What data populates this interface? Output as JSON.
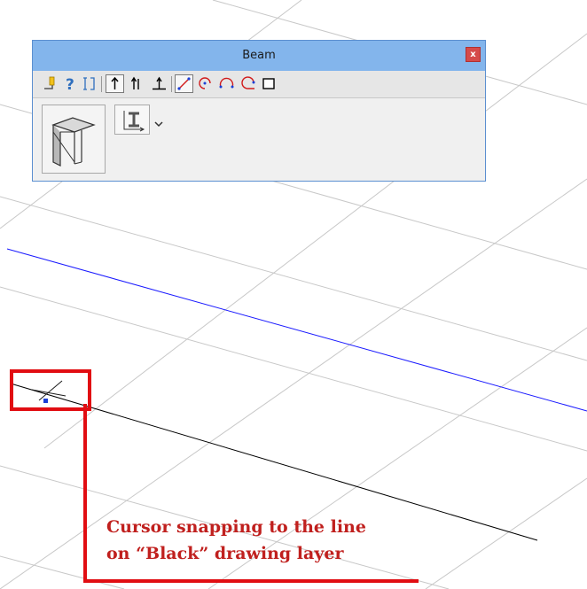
{
  "palette": {
    "title": "Beam",
    "close_label": "x",
    "tools": [
      {
        "icon": "pen-settings-icon"
      },
      {
        "icon": "help-icon"
      },
      {
        "icon": "profile-settings-icon"
      },
      {
        "icon": "arrow-up-icon"
      },
      {
        "icon": "double-arrow-icon"
      },
      {
        "icon": "perpendicular-arrow-icon"
      },
      {
        "icon": "straight-line-icon"
      },
      {
        "icon": "arc-center-icon"
      },
      {
        "icon": "arc-three-point-icon"
      },
      {
        "icon": "arc-tangent-icon"
      },
      {
        "icon": "rectangle-icon"
      }
    ],
    "selected_tools": [
      "arrow-up-icon",
      "straight-line-icon"
    ],
    "main_button_icon": "beam-3d-icon",
    "type_icon": "i-beam-profile-icon",
    "dropdown_icon": "chevron-down-icon"
  },
  "annotation": {
    "line1": "Cursor snapping to the line",
    "line2": "on “Black” drawing layer",
    "color": "#e10d12"
  },
  "lines": {
    "blue_layer_color": "#1a1aff",
    "black_layer_color": "#000000",
    "grid_color": "#c8c8c8",
    "cursor_color": "#1a3fd6"
  }
}
